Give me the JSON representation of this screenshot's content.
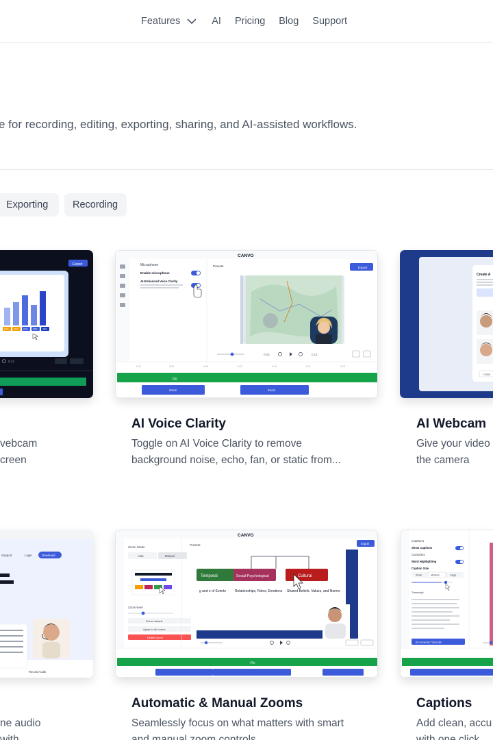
{
  "nav": {
    "items": [
      "Features",
      "AI",
      "Pricing",
      "Blog",
      "Support"
    ]
  },
  "description": "e for recording, editing, exporting, sharing, and AI-assisted workflows.",
  "filters": [
    "Exporting",
    "Recording"
  ],
  "cards_row1": [
    {
      "title": "",
      "desc_line1": "vebcam",
      "desc_line2": "creen"
    },
    {
      "title": "AI Voice Clarity",
      "desc_line1": "Toggle on AI Voice Clarity to remove",
      "desc_line2": "background noise, echo, fan, or static from..."
    },
    {
      "title": "AI Webcam",
      "desc_line1": "Give your video",
      "desc_line2": "the camera"
    }
  ],
  "cards_row2": [
    {
      "title": "",
      "desc_line1": "ne audio",
      "desc_line2": "with"
    },
    {
      "title": "Automatic & Manual Zooms",
      "desc_line1": "Seamlessly focus on what matters with smart",
      "desc_line2": "and manual zoom controls"
    },
    {
      "title": "Captions",
      "desc_line1": "Add clean, accu",
      "desc_line2": "with one click"
    }
  ],
  "screens": {
    "brand": "CANVO",
    "export_label": "Export",
    "presets_label": "Presets",
    "mic_panel": [
      "Microphone",
      "Enable microphone",
      "AI-Enhanced Voice Clarity"
    ],
    "zoom_panel": [
      "Zoom Mode",
      "Auto",
      "Manual",
      "Zoom level",
      "Set as default",
      "Apply to all zooms",
      "Delete Zoom"
    ],
    "diagram_boxes": [
      "Temporal",
      "Social-Psychological",
      "Cultural"
    ],
    "diagram_text": [
      "g and e of Events",
      "Relationships, Roles, Emotions",
      "Shared Beliefs, Values, and Norms"
    ],
    "captions_panel": [
      "Captions",
      "Show Captions",
      "Customize",
      "Word Highlighting",
      "Caption Size",
      "Small",
      "Medium",
      "Large",
      "Transcript",
      "Re-Generate Transcript"
    ],
    "webcam_panel": [
      "Create A",
      "Close"
    ],
    "timeline_labels": [
      "Clip",
      "Zoom",
      "Zoom"
    ],
    "time_labels": [
      "0:00",
      "0:12"
    ],
    "bar_values": [
      "24%",
      "27%",
      "21%",
      "30%",
      "33%"
    ],
    "audio_panel": [
      "Support",
      "Login",
      "Download",
      "Record Audio"
    ]
  },
  "colors": {
    "accent_blue": "#3b5bdb",
    "timeline_green": "#16a34a",
    "dark_bg": "#0b0f1e"
  }
}
